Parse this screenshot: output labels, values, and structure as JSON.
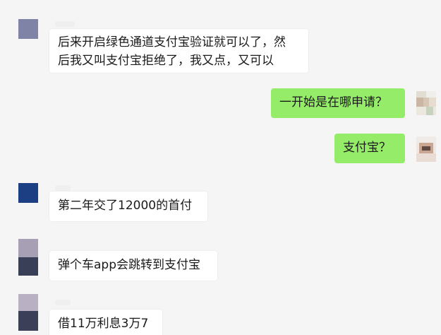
{
  "colors": {
    "background": "#f5f5f5",
    "incoming_bubble": "#ffffff",
    "outgoing_bubble": "#95ec69",
    "text": "#1a1a1a"
  },
  "messages": [
    {
      "direction": "incoming",
      "line1": "后来开启绿色通道支付宝验证就可以了，然",
      "line2": "后我又叫支付宝拒绝了，我又点，又可以"
    },
    {
      "direction": "outgoing",
      "text": "一开始是在哪申请？"
    },
    {
      "direction": "outgoing",
      "text": "支付宝？"
    },
    {
      "direction": "incoming",
      "text": "第二年交了12000的首付"
    },
    {
      "direction": "incoming",
      "text": "弹个车app会跳转到支付宝"
    },
    {
      "direction": "incoming",
      "text": "借11万利息3万7"
    }
  ]
}
